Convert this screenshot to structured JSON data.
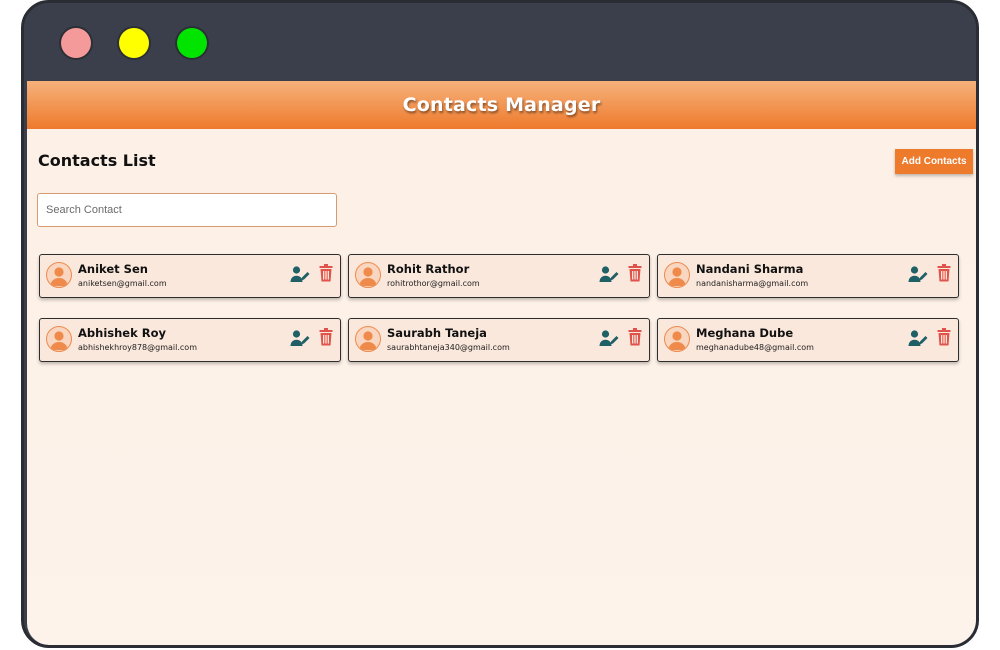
{
  "window": {
    "controls": [
      "close",
      "minimize",
      "maximize"
    ],
    "control_colors": [
      "#f59a9a",
      "#ffff00",
      "#00e400"
    ]
  },
  "app": {
    "title": "Contacts Manager",
    "accent_color": "#ee7a2c"
  },
  "contacts_section": {
    "title": "Contacts List",
    "add_button_label": "Add Contacts",
    "search_placeholder": "Search Contact",
    "search_value": ""
  },
  "contacts": [
    {
      "name": "Aniket Sen",
      "email": "aniketsen@gmail.com"
    },
    {
      "name": "Rohit Rathor",
      "email": "rohitrothor@gmail.com"
    },
    {
      "name": "Nandani Sharma",
      "email": "nandanisharma@gmail.com"
    },
    {
      "name": "Abhishek Roy",
      "email": "abhishekhroy878@gmail.com"
    },
    {
      "name": "Saurabh Taneja",
      "email": "saurabhtaneja340@gmail.com"
    },
    {
      "name": "Meghana Dube",
      "email": "meghanadube48@gmail.com"
    }
  ],
  "icons": {
    "avatar": "user-avatar-icon",
    "edit": "edit-user-icon",
    "delete": "trash-icon",
    "edit_color": "#1f5f66",
    "delete_color": "#e0534a"
  }
}
